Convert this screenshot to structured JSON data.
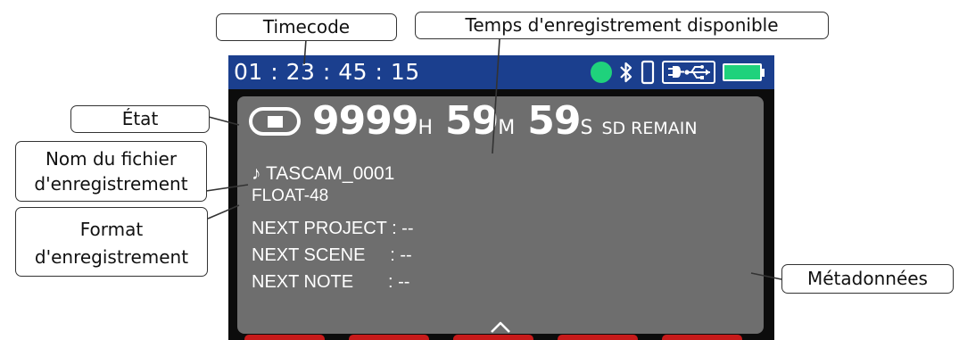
{
  "status_bar": {
    "timecode": "01 : 23 : 45 : 15",
    "icons": [
      "input-indicator-icon",
      "bluetooth-icon",
      "phone-icon",
      "usb-power-icon",
      "battery-icon"
    ],
    "colors": {
      "bar": "#1b3f8e",
      "indicator": "#1fd27c",
      "battery": "#1fd27c"
    }
  },
  "main": {
    "state_icon": "stop-icon",
    "remain": {
      "hours": "9999",
      "hours_unit": "H",
      "minutes": "59",
      "minutes_unit": "M",
      "seconds": "59",
      "seconds_unit": "S",
      "label": "SD REMAIN"
    },
    "file_icon": "♪",
    "file_name": "TASCAM_0001",
    "format": "FLOAT-48",
    "metadata": [
      {
        "text": "NEXT PROJECT : --"
      },
      {
        "text": "NEXT SCENE     : --"
      },
      {
        "text": "NEXT NOTE       : --"
      }
    ],
    "scroll_icon": "chevron-up-icon",
    "panel_color": "#6e6e6e",
    "tab_color": "#c71a1a"
  },
  "callouts": {
    "timecode": "Timecode",
    "time_available": "Temps d'enregistrement disponible",
    "state": "État",
    "file_name_line1": "Nom du fichier",
    "file_name_line2": "d'enregistrement",
    "format_line1": "Format",
    "format_line2": "d'enregistrement",
    "metadata": "Métadonnées"
  }
}
